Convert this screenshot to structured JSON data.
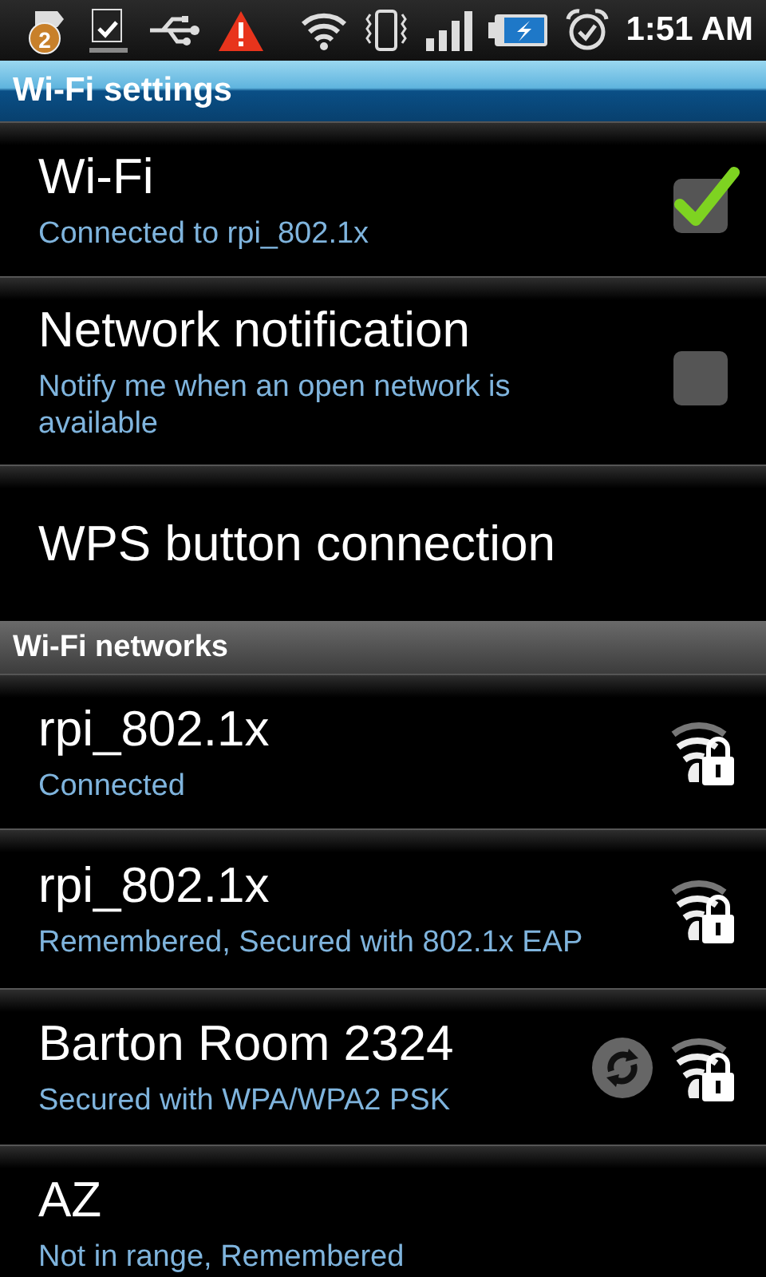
{
  "status_bar": {
    "notification_count": "2",
    "time": "1:51 AM"
  },
  "header": {
    "title": "Wi-Fi settings"
  },
  "settings": [
    {
      "kind": "checkbox",
      "title": "Wi-Fi",
      "summary": "Connected to rpi_802.1x",
      "checked": true
    },
    {
      "kind": "checkbox",
      "title": "Network notification",
      "summary": "Notify me when an open network is available",
      "checked": false
    },
    {
      "kind": "plain",
      "title": "WPS button connection"
    }
  ],
  "networks_header": {
    "title": "Wi-Fi networks"
  },
  "networks": [
    {
      "name": "rpi_802.1x",
      "status": "Connected",
      "in_range": true,
      "wps": false
    },
    {
      "name": "rpi_802.1x",
      "status": "Remembered, Secured with 802.1x EAP",
      "in_range": true,
      "wps": false
    },
    {
      "name": "Barton Room 2324",
      "status": "Secured with WPA/WPA2 PSK",
      "in_range": true,
      "wps": true
    },
    {
      "name": "AZ",
      "status": "Not in range, Remembered",
      "in_range": false,
      "wps": false
    }
  ]
}
